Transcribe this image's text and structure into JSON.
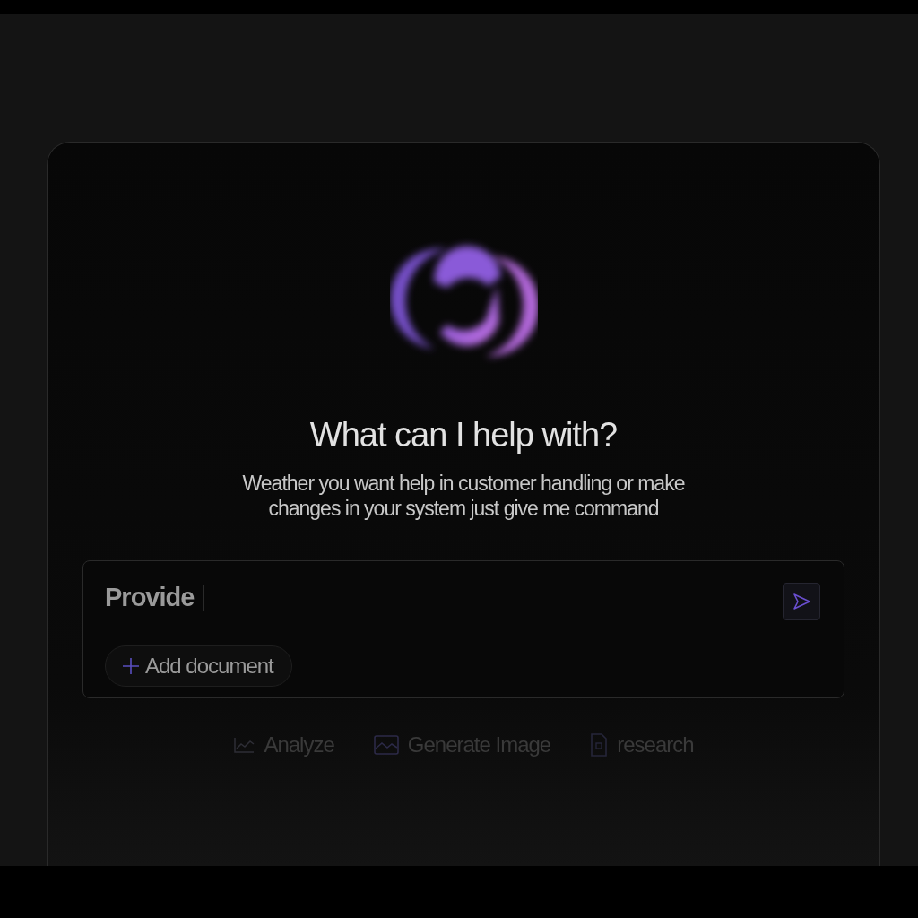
{
  "heading": "What can I help with?",
  "subtitle": [
    "Weather you want help in  customer handling or make",
    "changes in your system just give me command"
  ],
  "prompt": {
    "value": "Provide"
  },
  "attach_button": {
    "label": "Add document"
  },
  "suggestions": [
    {
      "kind": "chart",
      "label": "Analyze"
    },
    {
      "kind": "image",
      "label": "Generate Image"
    },
    {
      "kind": "file",
      "label": "research"
    }
  ]
}
